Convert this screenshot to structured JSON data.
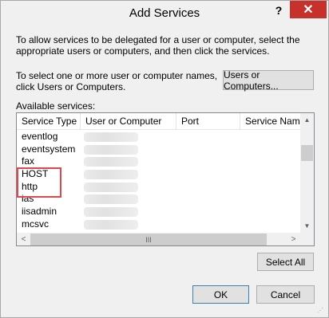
{
  "window": {
    "title": "Add Services",
    "help_label": "?",
    "close_label": "✕"
  },
  "description": "To allow services to be delegated for a user or computer, select the appropriate users or computers, and then click the services.",
  "select_prompt": "To select one or more user or computer names, click Users or Computers.",
  "buttons": {
    "users_or_computers": "Users or Computers...",
    "select_all": "Select All",
    "ok": "OK",
    "cancel": "Cancel"
  },
  "available_label": "Available services:",
  "table": {
    "columns": [
      "Service Type",
      "User or Computer",
      "Port",
      "Service Name"
    ],
    "rows": [
      "eventlog",
      "eventsystem",
      "fax",
      "HOST",
      "http",
      "ias",
      "iisadmin",
      "mcsvc"
    ]
  },
  "scrollbar": {
    "up_icon": "▲",
    "down_icon": "▼",
    "left_icon": "<",
    "right_icon": ">",
    "grip": "III"
  },
  "highlight_color": "#e0464b",
  "close_color": "#c8302b"
}
